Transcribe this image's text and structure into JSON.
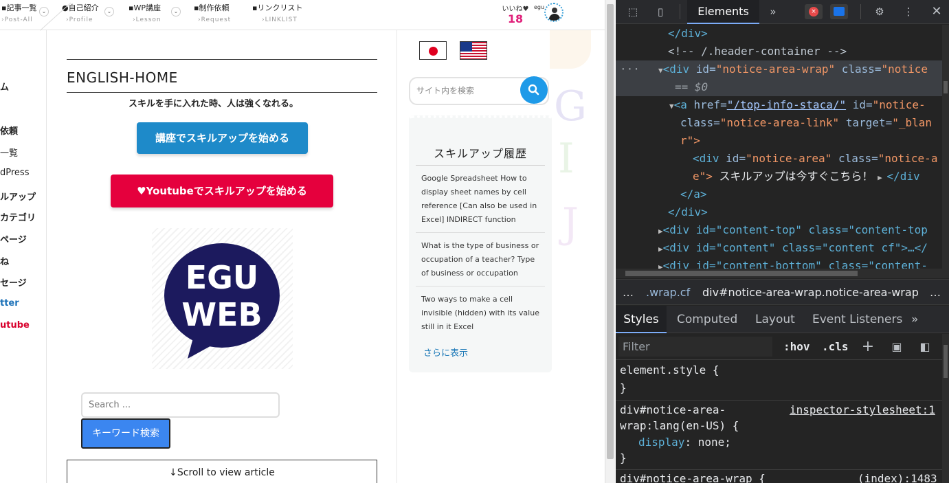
{
  "nav": {
    "items": [
      {
        "label": "記事一覧",
        "sub": "Post-All"
      },
      {
        "label": "自己紹介",
        "sub": "Profile"
      },
      {
        "label": "WP講座",
        "sub": "Lesson"
      },
      {
        "label": "制作依頼",
        "sub": "Request"
      },
      {
        "label": "リンクリスト",
        "sub": "LINKLIST"
      }
    ],
    "likes_label": "いいね♥",
    "likes_count": "18",
    "user": "egu"
  },
  "sidebar_left": {
    "items": [
      "ム",
      "依頼",
      "一覧",
      "dPress",
      "ルアップ",
      "カテゴリ",
      "ページ",
      "ね",
      "セージ",
      "tter",
      "utube"
    ]
  },
  "main": {
    "title": "ENGLISH-HOME",
    "tagline": "スキルを手に入れた時、人は強くなれる。",
    "btn_course": "講座でスキルアップを始める",
    "btn_youtube": "Youtubeでスキルアップを始める",
    "logo_line1": "EGU",
    "logo_line2": "WEB",
    "search_placeholder": "Search ...",
    "search_button": "キーワード検索",
    "scroll_hint": "↓Scroll to view article"
  },
  "right": {
    "site_search_placeholder": "サイト内を検索",
    "history_title": "スキルアップ履歴",
    "history_items": [
      "Google Spreadsheet How to display sheet names by cell reference [Can also be used in Excel] INDIRECT function",
      "What is the type of business or occupation of a teacher? Type of business or occupation",
      "Two ways to make a cell invisible (hidden) with its value still in it Excel"
    ],
    "more_link": "さらに表示"
  },
  "devtools": {
    "tab_elements": "Elements",
    "more_tabs": "»",
    "error_count": "×",
    "dom": {
      "l1": "</div>",
      "l2": "<!-- /.header-container -->",
      "l3_tag": "<div ",
      "l3_attr1": "id=",
      "l3_val1": "\"notice-area-wrap\"",
      "l3_attr2": " class=",
      "l3_val2": "\"notice",
      "l4": "== $0",
      "l5_tag": "<a ",
      "l5_attr1": "href=",
      "l5_val1": "\"/top-info-staca/\"",
      "l5_attr2": " id=",
      "l5_val2": "\"notice-",
      "l6_attr": "class=",
      "l6_val": "\"notice-area-link\"",
      "l6_attr2": " target=",
      "l6_val2": "\"_blan",
      "l7": "r\">",
      "l8_tag": "<div ",
      "l8_attr1": "id=",
      "l8_val1": "\"notice-area\"",
      "l8_attr2": " class=",
      "l8_val2": "\"notice-a",
      "l9_val": "e\">",
      "l9_text": " スキルアップは今すぐこちら！",
      "l9_tail": "</div",
      "l10": "</a>",
      "l11": "</div>",
      "l12": "<div id=\"content-top\" class=\"content-top",
      "l13": "<div id=\"content\" class=\"content cf\">…</",
      "l14": "<div id=\"content-bottom\" class=\"content-"
    },
    "crumbs": [
      "…",
      ".wrap.cf",
      "div#notice-area-wrap.notice-area-wrap",
      "…"
    ],
    "subtabs": [
      "Styles",
      "Computed",
      "Layout",
      "Event Listeners",
      "»"
    ],
    "filter_placeholder": "Filter",
    "hov": ":hov",
    "cls": ".cls",
    "styles": {
      "r1_sel": "element.style {",
      "r1_close": "}",
      "r2_sel1": "div#notice-area-",
      "r2_sel2": "wrap:lang(en-US) {",
      "r2_src": "inspector-stylesheet:1",
      "r2_prop": "display",
      "r2_val": ": none;",
      "r2_close": "}",
      "r3_sel": "div#notice-area-wrap {",
      "r3_src": "(index):1483"
    }
  },
  "colors": {
    "course_blue": "#1e8ac9",
    "youtube_red": "#e5003d",
    "likes_pink": "#e0207a",
    "search_blue": "#3b86f0",
    "devtools_bg": "#242424"
  }
}
